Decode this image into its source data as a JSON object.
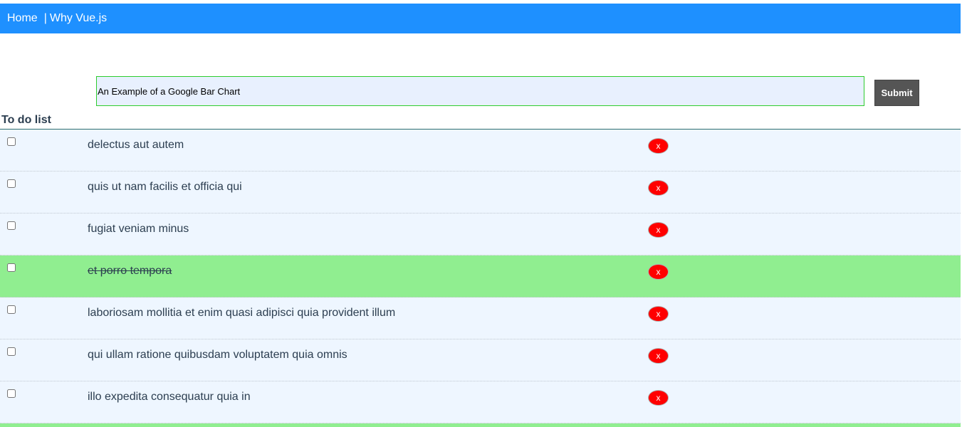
{
  "nav": {
    "home_label": "Home",
    "separator": "|",
    "why_label": "Why Vue.js"
  },
  "form": {
    "input_value": "An Example of a Google Bar Chart",
    "submit_label": "Submit"
  },
  "list": {
    "heading": "To do list",
    "delete_label": "x",
    "items": [
      {
        "text": "delectus aut autem",
        "completed": false
      },
      {
        "text": "quis ut nam facilis et officia qui",
        "completed": false
      },
      {
        "text": "fugiat veniam minus",
        "completed": false
      },
      {
        "text": "et porro tempora",
        "completed": true
      },
      {
        "text": "laboriosam mollitia et enim quasi adipisci quia provident illum",
        "completed": false
      },
      {
        "text": "qui ullam ratione quibusdam voluptatem quia omnis",
        "completed": false
      },
      {
        "text": "illo expedita consequatur quia in",
        "completed": false
      }
    ]
  },
  "colors": {
    "navbar": "#1e90ff",
    "row_background": "#eef6ff",
    "completed_row": "#90ee90",
    "delete_button": "#ff0000",
    "submit_button": "#555555",
    "input_border": "#2ecc2e"
  }
}
